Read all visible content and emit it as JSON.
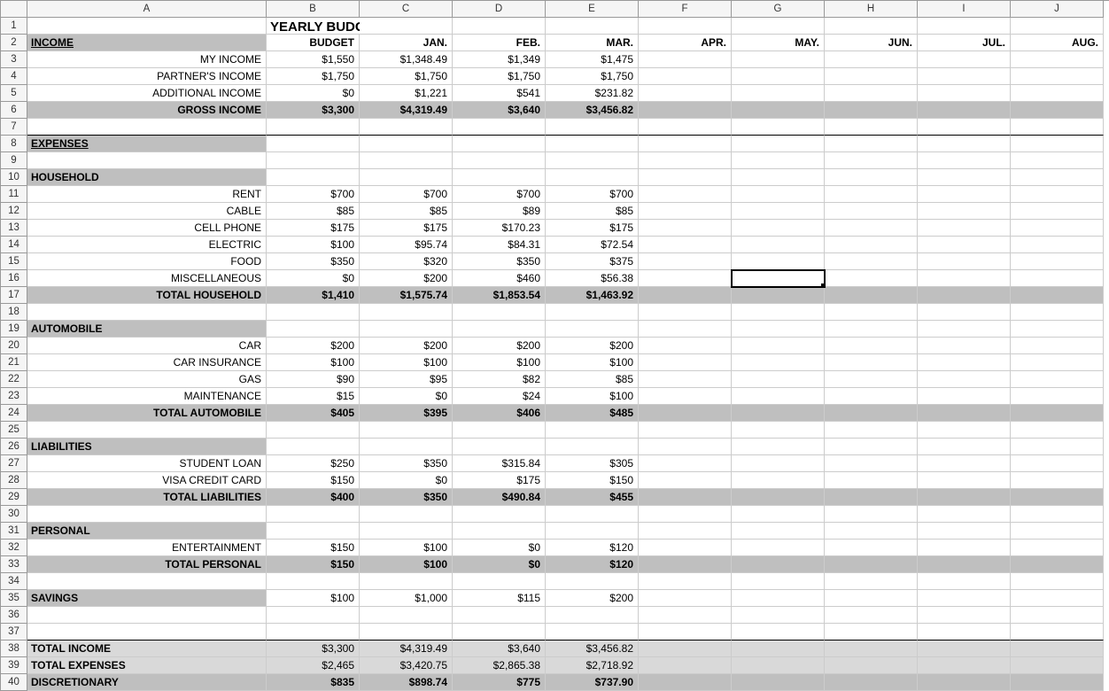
{
  "columns": [
    "A",
    "B",
    "C",
    "D",
    "E",
    "F",
    "G",
    "H",
    "I",
    "J"
  ],
  "rows": [
    {
      "n": 1,
      "style": [
        "",
        "title",
        "",
        "",
        "",
        "",
        "",
        "",
        "",
        ""
      ],
      "c": [
        "",
        "YEARLY BUDGET",
        "",
        "",
        "",
        "",
        "",
        "",
        "",
        ""
      ]
    },
    {
      "n": 2,
      "style": [
        "section-header greyfill",
        "bold right",
        "bold right",
        "bold right",
        "bold right",
        "bold right",
        "bold right",
        "bold right",
        "bold right",
        "bold right"
      ],
      "c": [
        "INCOME",
        "BUDGET",
        "JAN.",
        "FEB.",
        "MAR.",
        "APR.",
        "MAY.",
        "JUN.",
        "JUL.",
        "AUG."
      ]
    },
    {
      "n": 3,
      "style": [
        "right",
        "right",
        "right",
        "right",
        "right",
        "",
        "",
        "",
        "",
        ""
      ],
      "c": [
        "MY INCOME",
        "$1,550",
        "$1,348.49",
        "$1,349",
        "$1,475",
        "",
        "",
        "",
        "",
        ""
      ]
    },
    {
      "n": 4,
      "style": [
        "right",
        "right",
        "right",
        "right",
        "right",
        "",
        "",
        "",
        "",
        ""
      ],
      "c": [
        "PARTNER'S INCOME",
        "$1,750",
        "$1,750",
        "$1,750",
        "$1,750",
        "",
        "",
        "",
        "",
        ""
      ]
    },
    {
      "n": 5,
      "style": [
        "right",
        "right",
        "right",
        "right",
        "right",
        "",
        "",
        "",
        "",
        ""
      ],
      "c": [
        "ADDITIONAL INCOME",
        "$0",
        "$1,221",
        "$541",
        "$231.82",
        "",
        "",
        "",
        "",
        ""
      ]
    },
    {
      "n": 6,
      "style": [
        "bold right greyfill",
        "bold right greyfill",
        "bold right greyfill",
        "bold right greyfill",
        "bold right greyfill",
        "greyfill",
        "greyfill",
        "greyfill",
        "greyfill",
        "greyfill"
      ],
      "c": [
        "GROSS INCOME",
        "$3,300",
        "$4,319.49",
        "$3,640",
        "$3,456.82",
        "",
        "",
        "",
        "",
        ""
      ]
    },
    {
      "n": 7,
      "style": [
        "thickbottom",
        "thickbottom",
        "thickbottom",
        "thickbottom",
        "thickbottom",
        "thickbottom",
        "thickbottom",
        "thickbottom",
        "thickbottom",
        "thickbottom"
      ],
      "c": [
        "",
        "",
        "",
        "",
        "",
        "",
        "",
        "",
        "",
        ""
      ]
    },
    {
      "n": 8,
      "style": [
        "section-header greyfill",
        "",
        "",
        "",
        "",
        "",
        "",
        "",
        "",
        ""
      ],
      "c": [
        "EXPENSES",
        "",
        "",
        "",
        "",
        "",
        "",
        "",
        "",
        ""
      ]
    },
    {
      "n": 9,
      "style": [
        "",
        "",
        "",
        "",
        "",
        "",
        "",
        "",
        "",
        ""
      ],
      "c": [
        "",
        "",
        "",
        "",
        "",
        "",
        "",
        "",
        "",
        ""
      ]
    },
    {
      "n": 10,
      "style": [
        "section-plain greyfill",
        "",
        "",
        "",
        "",
        "",
        "",
        "",
        "",
        ""
      ],
      "c": [
        "HOUSEHOLD",
        "",
        "",
        "",
        "",
        "",
        "",
        "",
        "",
        ""
      ]
    },
    {
      "n": 11,
      "style": [
        "right",
        "right",
        "right",
        "right",
        "right",
        "",
        "",
        "",
        "",
        ""
      ],
      "c": [
        "RENT",
        "$700",
        "$700",
        "$700",
        "$700",
        "",
        "",
        "",
        "",
        ""
      ]
    },
    {
      "n": 12,
      "style": [
        "right",
        "right",
        "right",
        "right",
        "right",
        "",
        "",
        "",
        "",
        ""
      ],
      "c": [
        "CABLE",
        "$85",
        "$85",
        "$89",
        "$85",
        "",
        "",
        "",
        "",
        ""
      ]
    },
    {
      "n": 13,
      "style": [
        "right",
        "right",
        "right",
        "right",
        "right",
        "",
        "",
        "",
        "",
        ""
      ],
      "c": [
        "CELL PHONE",
        "$175",
        "$175",
        "$170.23",
        "$175",
        "",
        "",
        "",
        "",
        ""
      ]
    },
    {
      "n": 14,
      "style": [
        "right",
        "right",
        "right",
        "right",
        "right",
        "",
        "",
        "",
        "",
        ""
      ],
      "c": [
        "ELECTRIC",
        "$100",
        "$95.74",
        "$84.31",
        "$72.54",
        "",
        "",
        "",
        "",
        ""
      ]
    },
    {
      "n": 15,
      "style": [
        "right",
        "right",
        "right",
        "right",
        "right",
        "",
        "",
        "",
        "",
        ""
      ],
      "c": [
        "FOOD",
        "$350",
        "$320",
        "$350",
        "$375",
        "",
        "",
        "",
        "",
        ""
      ]
    },
    {
      "n": 16,
      "style": [
        "right",
        "right",
        "right",
        "right",
        "right",
        "",
        "selected",
        "",
        "",
        ""
      ],
      "c": [
        "MISCELLANEOUS",
        "$0",
        "$200",
        "$460",
        "$56.38",
        "",
        "",
        "",
        "",
        ""
      ]
    },
    {
      "n": 17,
      "style": [
        "bold right greyfill",
        "bold right greyfill",
        "bold right greyfill",
        "bold right greyfill",
        "bold right greyfill",
        "greyfill",
        "greyfill",
        "greyfill",
        "greyfill",
        "greyfill"
      ],
      "c": [
        "TOTAL HOUSEHOLD",
        "$1,410",
        "$1,575.74",
        "$1,853.54",
        "$1,463.92",
        "",
        "",
        "",
        "",
        ""
      ]
    },
    {
      "n": 18,
      "style": [
        "",
        "",
        "",
        "",
        "",
        "",
        "",
        "",
        "",
        ""
      ],
      "c": [
        "",
        "",
        "",
        "",
        "",
        "",
        "",
        "",
        "",
        ""
      ]
    },
    {
      "n": 19,
      "style": [
        "section-plain greyfill",
        "",
        "",
        "",
        "",
        "",
        "",
        "",
        "",
        ""
      ],
      "c": [
        "AUTOMOBILE",
        "",
        "",
        "",
        "",
        "",
        "",
        "",
        "",
        ""
      ]
    },
    {
      "n": 20,
      "style": [
        "right",
        "right",
        "right",
        "right",
        "right",
        "",
        "",
        "",
        "",
        ""
      ],
      "c": [
        "CAR",
        "$200",
        "$200",
        "$200",
        "$200",
        "",
        "",
        "",
        "",
        ""
      ]
    },
    {
      "n": 21,
      "style": [
        "right",
        "right",
        "right",
        "right",
        "right",
        "",
        "",
        "",
        "",
        ""
      ],
      "c": [
        "CAR INSURANCE",
        "$100",
        "$100",
        "$100",
        "$100",
        "",
        "",
        "",
        "",
        ""
      ]
    },
    {
      "n": 22,
      "style": [
        "right",
        "right",
        "right",
        "right",
        "right",
        "",
        "",
        "",
        "",
        ""
      ],
      "c": [
        "GAS",
        "$90",
        "$95",
        "$82",
        "$85",
        "",
        "",
        "",
        "",
        ""
      ]
    },
    {
      "n": 23,
      "style": [
        "right",
        "right",
        "right",
        "right",
        "right",
        "",
        "",
        "",
        "",
        ""
      ],
      "c": [
        "MAINTENANCE",
        "$15",
        "$0",
        "$24",
        "$100",
        "",
        "",
        "",
        "",
        ""
      ]
    },
    {
      "n": 24,
      "style": [
        "bold right greyfill",
        "bold right greyfill",
        "bold right greyfill",
        "bold right greyfill",
        "bold right greyfill",
        "greyfill",
        "greyfill",
        "greyfill",
        "greyfill",
        "greyfill"
      ],
      "c": [
        "TOTAL AUTOMOBILE",
        "$405",
        "$395",
        "$406",
        "$485",
        "",
        "",
        "",
        "",
        ""
      ]
    },
    {
      "n": 25,
      "style": [
        "",
        "",
        "",
        "",
        "",
        "",
        "",
        "",
        "",
        ""
      ],
      "c": [
        "",
        "",
        "",
        "",
        "",
        "",
        "",
        "",
        "",
        ""
      ]
    },
    {
      "n": 26,
      "style": [
        "section-plain greyfill",
        "",
        "",
        "",
        "",
        "",
        "",
        "",
        "",
        ""
      ],
      "c": [
        "LIABILITIES",
        "",
        "",
        "",
        "",
        "",
        "",
        "",
        "",
        ""
      ]
    },
    {
      "n": 27,
      "style": [
        "right",
        "right",
        "right",
        "right",
        "right",
        "",
        "",
        "",
        "",
        ""
      ],
      "c": [
        "STUDENT LOAN",
        "$250",
        "$350",
        "$315.84",
        "$305",
        "",
        "",
        "",
        "",
        ""
      ]
    },
    {
      "n": 28,
      "style": [
        "right",
        "right",
        "right",
        "right",
        "right",
        "",
        "",
        "",
        "",
        ""
      ],
      "c": [
        "VISA CREDIT CARD",
        "$150",
        "$0",
        "$175",
        "$150",
        "",
        "",
        "",
        "",
        ""
      ]
    },
    {
      "n": 29,
      "style": [
        "bold right greyfill",
        "bold right greyfill",
        "bold right greyfill",
        "bold right greyfill",
        "bold right greyfill",
        "greyfill",
        "greyfill",
        "greyfill",
        "greyfill",
        "greyfill"
      ],
      "c": [
        "TOTAL LIABILITIES",
        "$400",
        "$350",
        "$490.84",
        "$455",
        "",
        "",
        "",
        "",
        ""
      ]
    },
    {
      "n": 30,
      "style": [
        "",
        "",
        "",
        "",
        "",
        "",
        "",
        "",
        "",
        ""
      ],
      "c": [
        "",
        "",
        "",
        "",
        "",
        "",
        "",
        "",
        "",
        ""
      ]
    },
    {
      "n": 31,
      "style": [
        "section-plain greyfill",
        "",
        "",
        "",
        "",
        "",
        "",
        "",
        "",
        ""
      ],
      "c": [
        "PERSONAL",
        "",
        "",
        "",
        "",
        "",
        "",
        "",
        "",
        ""
      ]
    },
    {
      "n": 32,
      "style": [
        "right",
        "right",
        "right",
        "right",
        "right",
        "",
        "",
        "",
        "",
        ""
      ],
      "c": [
        "ENTERTAINMENT",
        "$150",
        "$100",
        "$0",
        "$120",
        "",
        "",
        "",
        "",
        ""
      ]
    },
    {
      "n": 33,
      "style": [
        "bold right greyfill",
        "bold right greyfill",
        "bold right greyfill",
        "bold right greyfill",
        "bold right greyfill",
        "greyfill",
        "greyfill",
        "greyfill",
        "greyfill",
        "greyfill"
      ],
      "c": [
        "TOTAL PERSONAL",
        "$150",
        "$100",
        "$0",
        "$120",
        "",
        "",
        "",
        "",
        ""
      ]
    },
    {
      "n": 34,
      "style": [
        "",
        "",
        "",
        "",
        "",
        "",
        "",
        "",
        "",
        ""
      ],
      "c": [
        "",
        "",
        "",
        "",
        "",
        "",
        "",
        "",
        "",
        ""
      ]
    },
    {
      "n": 35,
      "style": [
        "section-plain greyfill",
        "right",
        "right",
        "right",
        "right",
        "",
        "",
        "",
        "",
        ""
      ],
      "c": [
        "SAVINGS",
        "$100",
        "$1,000",
        "$115",
        "$200",
        "",
        "",
        "",
        "",
        ""
      ]
    },
    {
      "n": 36,
      "style": [
        "",
        "",
        "",
        "",
        "",
        "",
        "",
        "",
        "",
        ""
      ],
      "c": [
        "",
        "",
        "",
        "",
        "",
        "",
        "",
        "",
        "",
        ""
      ]
    },
    {
      "n": 37,
      "style": [
        "thickbottom",
        "thickbottom",
        "thickbottom",
        "thickbottom",
        "thickbottom",
        "thickbottom",
        "thickbottom",
        "thickbottom",
        "thickbottom",
        "thickbottom"
      ],
      "c": [
        "",
        "",
        "",
        "",
        "",
        "",
        "",
        "",
        "",
        ""
      ]
    },
    {
      "n": 38,
      "style": [
        "section-plain ltgreyfill",
        "right ltgreyfill",
        "right ltgreyfill",
        "right ltgreyfill",
        "right ltgreyfill",
        "ltgreyfill",
        "ltgreyfill",
        "ltgreyfill",
        "ltgreyfill",
        "ltgreyfill"
      ],
      "c": [
        "TOTAL INCOME",
        "$3,300",
        "$4,319.49",
        "$3,640",
        "$3,456.82",
        "",
        "",
        "",
        "",
        ""
      ]
    },
    {
      "n": 39,
      "style": [
        "section-plain ltgreyfill",
        "right ltgreyfill",
        "right ltgreyfill",
        "right ltgreyfill",
        "right ltgreyfill",
        "ltgreyfill",
        "ltgreyfill",
        "ltgreyfill",
        "ltgreyfill",
        "ltgreyfill"
      ],
      "c": [
        "TOTAL EXPENSES",
        "$2,465",
        "$3,420.75",
        "$2,865.38",
        "$2,718.92",
        "",
        "",
        "",
        "",
        ""
      ]
    },
    {
      "n": 40,
      "style": [
        "section-plain greyfill",
        "bold right greyfill",
        "bold right greyfill",
        "bold right greyfill",
        "bold right greyfill",
        "greyfill",
        "greyfill",
        "greyfill",
        "greyfill",
        "greyfill"
      ],
      "c": [
        "DISCRETIONARY",
        "$835",
        "$898.74",
        "$775",
        "$737.90",
        "",
        "",
        "",
        "",
        ""
      ]
    }
  ]
}
